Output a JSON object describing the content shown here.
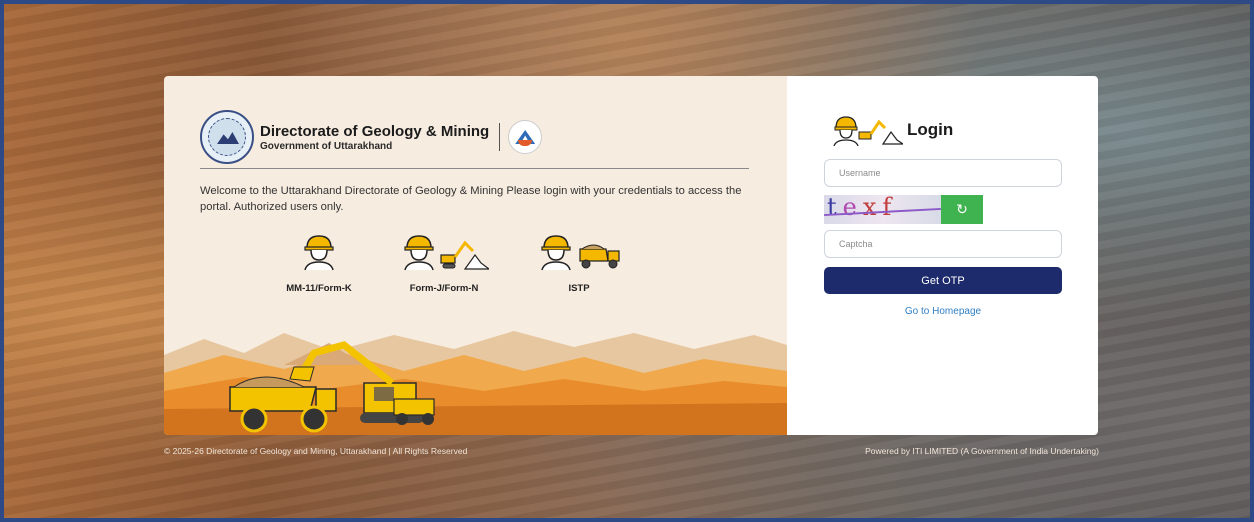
{
  "brand": {
    "title": "Directorate of Geology & Mining",
    "subtitle": "Government of Uttarakhand"
  },
  "welcome_text": "Welcome to the Uttarakhand Directorate of Geology & Mining Please login with your credentials to access the portal. Authorized users only.",
  "roles": [
    {
      "label": "MM-11/Form-K",
      "icon": "worker-icon"
    },
    {
      "label": "Form-J/Form-N",
      "icon": "worker-excavator-icon"
    },
    {
      "label": "ISTP",
      "icon": "worker-truck-icon"
    }
  ],
  "login": {
    "title": "Login",
    "username_placeholder": "Username",
    "username_value": "",
    "captcha_text": "texf",
    "captcha_placeholder": "Captcha",
    "captcha_value": "",
    "refresh_icon": "refresh-icon",
    "otp_button": "Get OTP",
    "home_link": "Go to Homepage"
  },
  "footer": {
    "copyright": "© 2025-26 Directorate of Geology and Mining, Uttarakhand | All Rights Reserved",
    "powered_by": "Powered by ITI LIMITED (A Government of India Undertaking)"
  },
  "colors": {
    "primary_button": "#1d2a6b",
    "refresh_button": "#3fb34f",
    "link": "#2f7fc4",
    "panel_bg": "#f7ece0",
    "helmet": "#f5b800"
  }
}
